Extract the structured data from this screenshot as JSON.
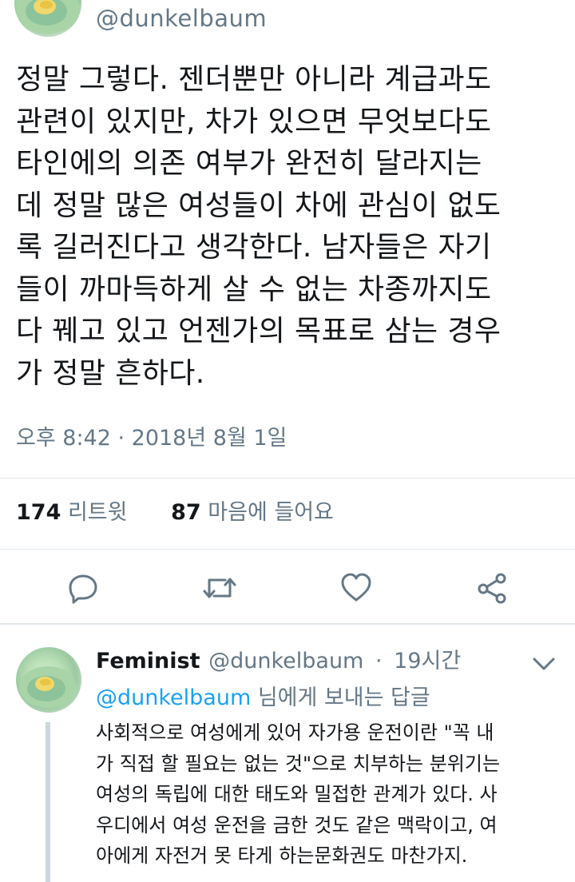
{
  "main_tweet": {
    "handle": "@dunkelbaum",
    "lines": [
      "정말 그렇다. 젠더뿐만 아니라 계급과도",
      "관련이 있지만, 차가 있으면 무엇보다도",
      "타인에의 의존 여부가 완전히 달라지는",
      "데 정말 많은 여성들이 차에 관심이 없도",
      "록 길러진다고 생각한다. 남자들은 자기",
      "들이 까마득하게 살 수 없는 차종까지도",
      "다 꿰고 있고 언젠가의 목표로 삼는 경우",
      "가 정말 흔하다."
    ],
    "timestamp": "오후 8:42 · 2018년 8월 1일",
    "retweet_count": "174",
    "retweet_label": "리트윗",
    "like_count": "87",
    "like_label": "마음에 들어요"
  },
  "actions": {
    "reply_icon": "reply-icon",
    "retweet_icon": "retweet-icon",
    "like_icon": "heart-icon",
    "share_icon": "share-icon"
  },
  "reply": {
    "display_name": "Feminist",
    "handle": "@dunkelbaum",
    "separator": "·",
    "time": "19시간",
    "replying_to": "@dunkelbaum",
    "replying_suffix": "님에게 보내는 답글",
    "lines": [
      "사회적으로 여성에게 있어 자가용 운전이란 \"꼭 내",
      "가 직접 할 필요는 없는 것\"으로 치부하는 분위기는",
      "여성의 독립에 대한 태도와 밀접한 관계가 있다. 사",
      "우디에서 여성 운전을 금한 것도 같은 맥락이고, 여",
      "아에게 자전거 못 타게 하는문화권도 마찬가지."
    ]
  },
  "colors": {
    "text": "#14171a",
    "muted": "#657786",
    "link": "#1da1f2",
    "divider": "#e1e8ed",
    "thread_line": "#ccd6dd"
  }
}
